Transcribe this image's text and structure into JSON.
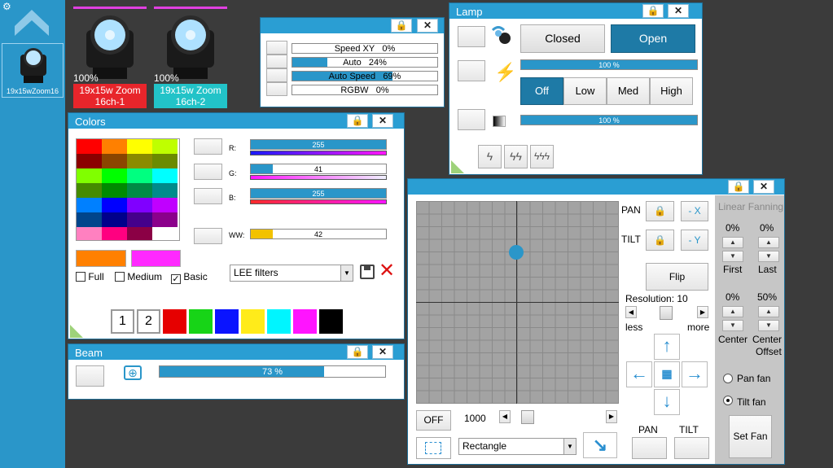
{
  "sidebar": {
    "fixture_label": "19x15wZoom16",
    "settings_icon": "gear-icon",
    "up_icon": "chevron-up-icon"
  },
  "fixtures": [
    {
      "percent": "100%",
      "name1": "19x15w Zoom",
      "name2": "16ch-1",
      "color": "#e8252b"
    },
    {
      "percent": "100%",
      "name1": "19x15w Zoom",
      "name2": "16ch-2",
      "color": "#22c3c8"
    }
  ],
  "speed": {
    "rows": [
      {
        "label": "Speed XY",
        "value": "0%",
        "fill": 0
      },
      {
        "label": "Auto",
        "value": "24%",
        "fill": 0.24
      },
      {
        "label": "Auto Speed",
        "value": "69%",
        "fill": 0.69
      },
      {
        "label": "RGBW",
        "value": "0%",
        "fill": 0
      }
    ]
  },
  "colors": {
    "title": "Colors",
    "rgb": [
      {
        "label": "R:",
        "value": "255",
        "fill": 1.0
      },
      {
        "label": "G:",
        "value": "41",
        "fill": 0.16
      },
      {
        "label": "B:",
        "value": "255",
        "fill": 1.0
      }
    ],
    "ww": {
      "label": "WW:",
      "value": "42",
      "fill": 0.16
    },
    "checks": [
      {
        "label": "Full",
        "checked": false
      },
      {
        "label": "Medium",
        "checked": false
      },
      {
        "label": "Basic",
        "checked": true
      }
    ],
    "filter": "LEE filters",
    "presets": [
      "1",
      "2"
    ],
    "swatches": [
      "#e60000",
      "#17d417",
      "#0a14ff",
      "#ffeb1a",
      "#00f5ff",
      "#ff14ff",
      "#000000"
    ]
  },
  "lamp": {
    "title": "Lamp",
    "closed": "Closed",
    "open": "Open",
    "pct1": "100 %",
    "pct2": "100 %",
    "levels": [
      "Off",
      "Low",
      "Med",
      "High"
    ]
  },
  "beam": {
    "title": "Beam",
    "value": "73 %",
    "fill": 0.73
  },
  "pantilt": {
    "pan": "PAN",
    "tilt": "TILT",
    "neg_x": "- X",
    "neg_y": "- Y",
    "flip": "Flip",
    "resolution": "Resolution: 10",
    "less": "less",
    "more": "more",
    "off": "OFF",
    "speed_value": "1000",
    "shape": "Rectangle",
    "pan_btn": "PAN",
    "tilt_btn": "TILT"
  },
  "fanning": {
    "title": "Linear Fanning",
    "first_val": "0%",
    "last_val": "0%",
    "first": "First",
    "last": "Last",
    "center_val": "0%",
    "offset_val": "50%",
    "center": "Center",
    "offset_1": "Center",
    "offset_2": "Offset",
    "pan_fan": "Pan fan",
    "tilt_fan": "Tilt fan",
    "set_fan": "Set Fan"
  }
}
